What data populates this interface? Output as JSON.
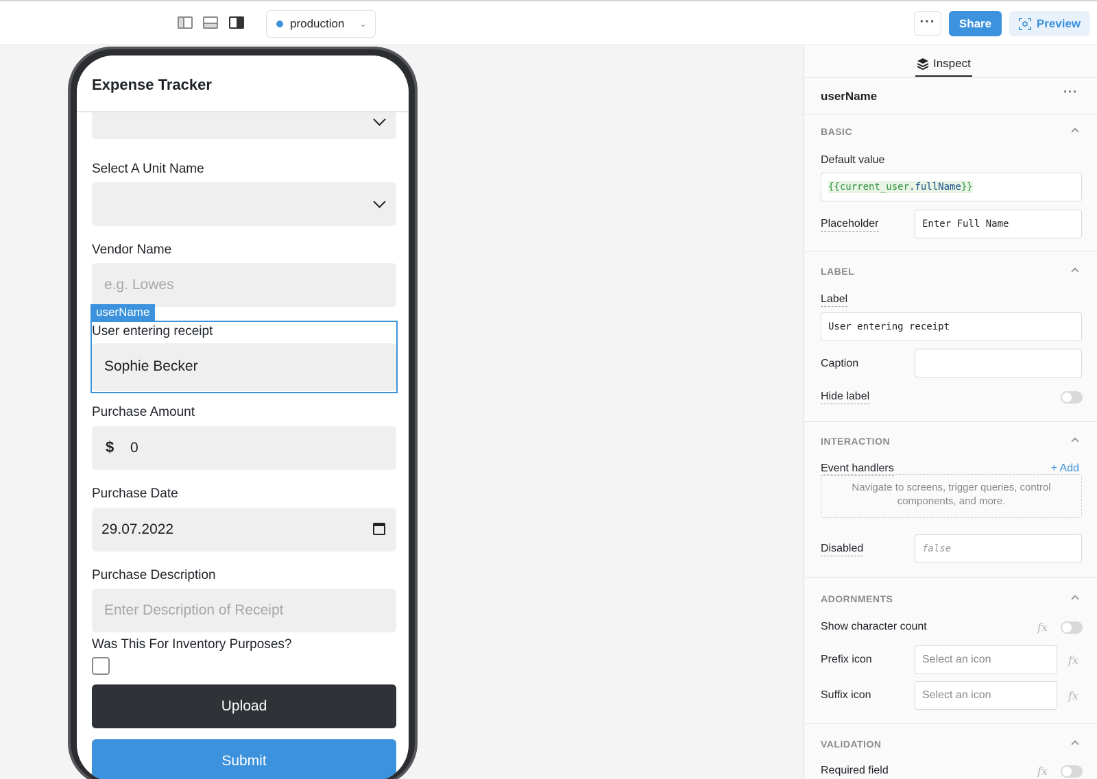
{
  "toolbar": {
    "environment": "production",
    "more_label": "···",
    "share_label": "Share",
    "preview_label": "Preview"
  },
  "app": {
    "title": "Expense Tracker",
    "unit_label": "Select A Unit Name",
    "vendor_label": "Vendor Name",
    "vendor_placeholder": "e.g. Lowes",
    "selected_tag": "userName",
    "user_label": "User entering receipt",
    "user_value": "Sophie Becker",
    "amount_label": "Purchase Amount",
    "amount_prefix": "$",
    "amount_value": "0",
    "date_label": "Purchase Date",
    "date_value": "29.07.2022",
    "description_label": "Purchase Description",
    "description_placeholder": "Enter Description of Receipt",
    "inventory_label": "Was This For Inventory Purposes?",
    "upload_label": "Upload",
    "submit_label": "Submit"
  },
  "inspector": {
    "tab_label": "Inspect",
    "component_name": "userName",
    "more_label": "···",
    "basic": {
      "title": "BASIC",
      "default_value_label": "Default value",
      "default_value_open": "{{",
      "default_value_var": "current_user",
      "default_value_prop": ".fullName",
      "default_value_close": "}}",
      "placeholder_label": "Placeholder",
      "placeholder_value": "Enter Full Name"
    },
    "label_section": {
      "title": "LABEL",
      "label_label": "Label",
      "label_value": "User entering receipt",
      "caption_label": "Caption",
      "caption_value": "",
      "hide_label": "Hide label"
    },
    "interaction": {
      "title": "INTERACTION",
      "event_handlers_label": "Event handlers",
      "add_label": "+ Add",
      "empty_text": "Navigate to screens, trigger queries, control components, and more.",
      "disabled_label": "Disabled",
      "disabled_value": "false"
    },
    "adornments": {
      "title": "ADORNMENTS",
      "char_count_label": "Show character count",
      "prefix_label": "Prefix icon",
      "prefix_placeholder": "Select an icon",
      "suffix_label": "Suffix icon",
      "suffix_placeholder": "Select an icon",
      "fx_label": "fx"
    },
    "validation": {
      "title": "VALIDATION",
      "required_label": "Required field"
    }
  }
}
